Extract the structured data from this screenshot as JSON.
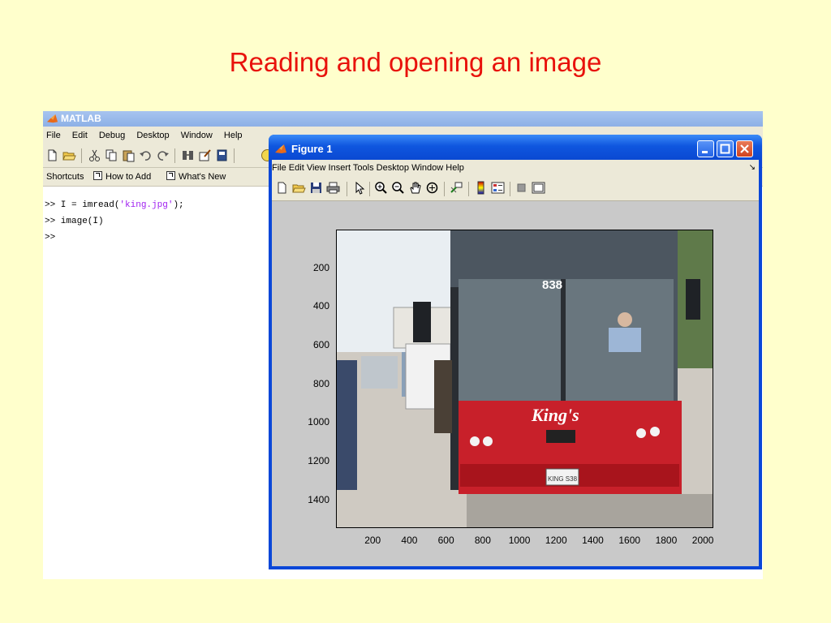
{
  "slide": {
    "title": "Reading and opening an image"
  },
  "matlab": {
    "title": "MATLAB",
    "menu": [
      "File",
      "Edit",
      "Debug",
      "Desktop",
      "Window",
      "Help"
    ],
    "shortcuts": {
      "label": "Shortcuts",
      "how_to_add": "How to Add",
      "whats_new": "What's New"
    },
    "command_window": {
      "line1_prefix": ">> I = imread(",
      "line1_string": "'king.jpg'",
      "line1_suffix": ");",
      "line2": ">> image(I)",
      "line3": ">>"
    }
  },
  "figure": {
    "title": "Figure 1",
    "menu": [
      "File",
      "Edit",
      "View",
      "Insert",
      "Tools",
      "Desktop",
      "Window",
      "Help"
    ],
    "window_buttons": [
      "minimize",
      "maximize",
      "close"
    ],
    "axes": {
      "yticks": [
        "200",
        "400",
        "600",
        "800",
        "1000",
        "1200",
        "1400"
      ],
      "xticks": [
        "200",
        "400",
        "600",
        "800",
        "1000",
        "1200",
        "1400",
        "1600",
        "1800",
        "2000"
      ],
      "ylim": [
        0,
        1536
      ],
      "xlim": [
        0,
        2048
      ]
    },
    "image": {
      "bus_number": "838",
      "bus_brand": "King's",
      "plate": "KING S38"
    }
  },
  "colors": {
    "slide_background": "#FFFFCC",
    "title_color": "#E8120C",
    "figure_frame": "#0A47D8",
    "bus_red": "#C8202A"
  }
}
